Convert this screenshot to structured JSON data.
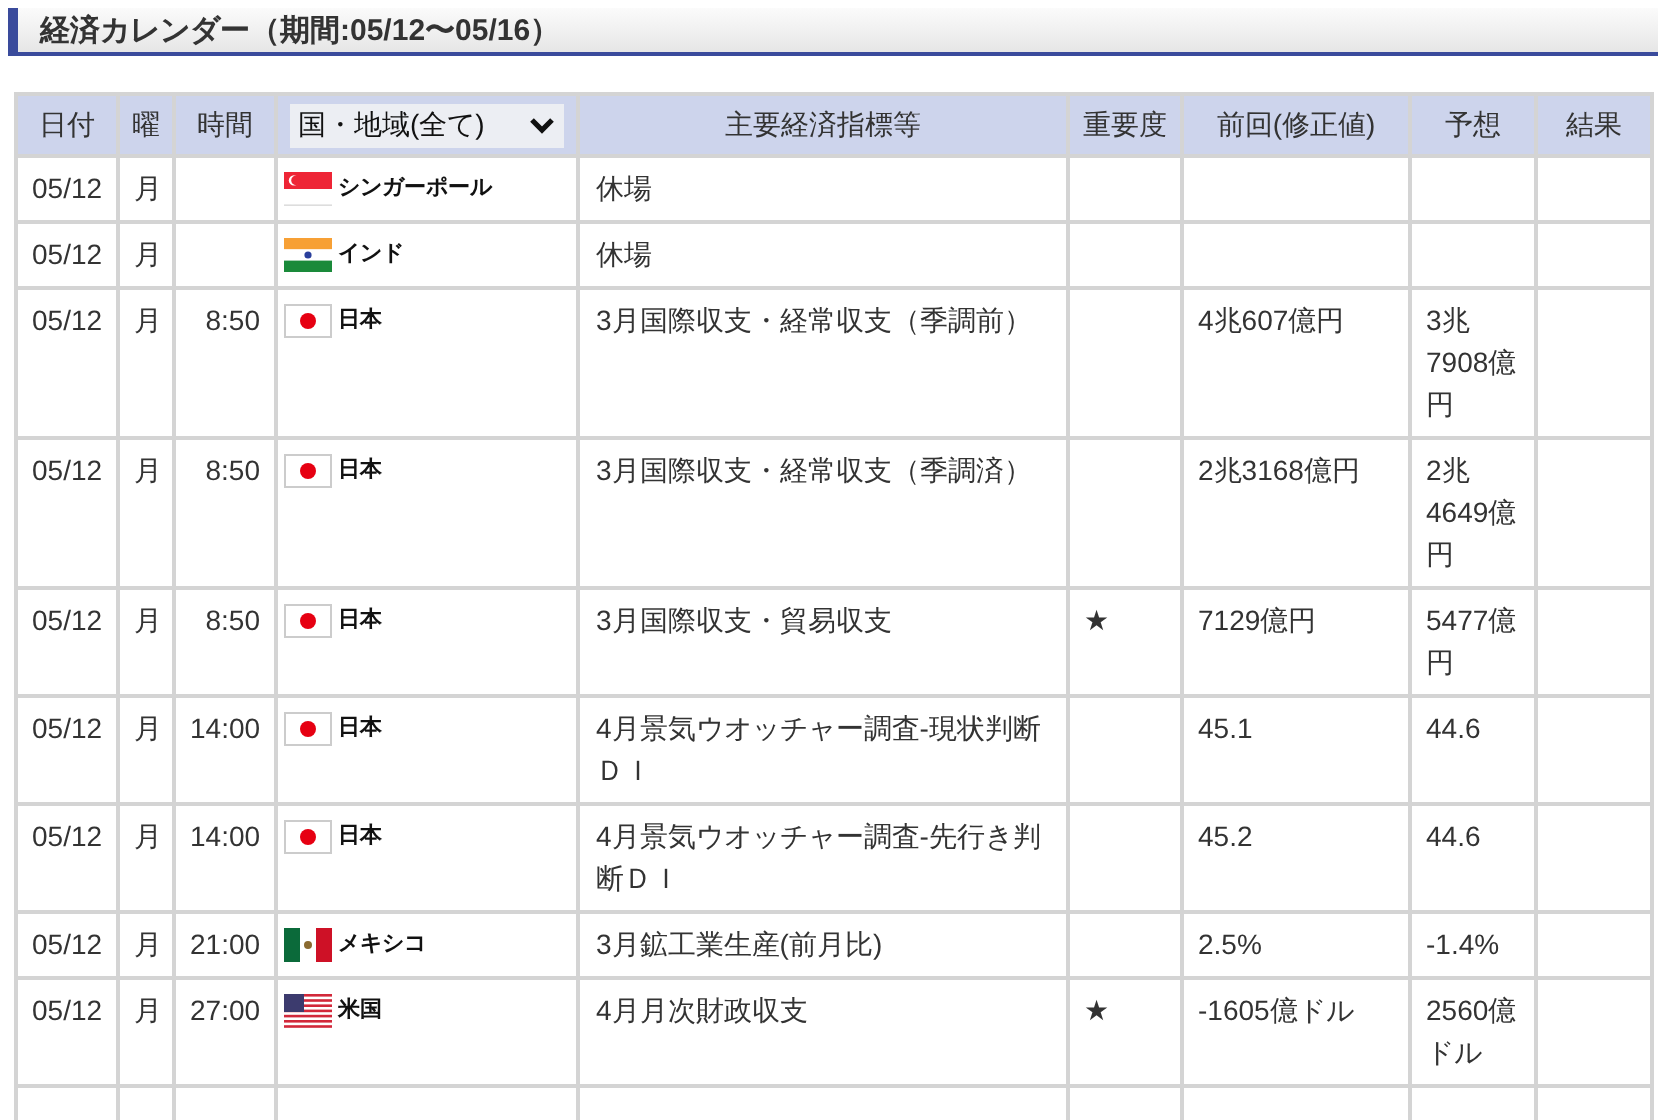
{
  "title": "経済カレンダー（期間:05/12〜05/16）",
  "columns": {
    "date": "日付",
    "day": "曜",
    "time": "時間",
    "region_filter": "国・地域(全て)",
    "indicator": "主要経済指標等",
    "importance": "重要度",
    "previous": "前回(修正値)",
    "forecast": "予想",
    "result": "結果"
  },
  "rows": [
    {
      "date": "05/12",
      "day": "月",
      "kind": "sg",
      "country": "シンガーポール",
      "indicator": "休場"
    },
    {
      "date": "05/12",
      "day": "月",
      "kind": "in",
      "country": "インド",
      "indicator": "休場"
    },
    {
      "date": "05/12",
      "day": "月",
      "time": "8:50",
      "kind": "jp",
      "country": "日本",
      "indicator": "3月国際収支・経常収支（季調前）",
      "previous": "4兆607億円",
      "forecast": "3兆7908億円"
    },
    {
      "date": "05/12",
      "day": "月",
      "time": "8:50",
      "kind": "jp",
      "country": "日本",
      "indicator": "3月国際収支・経常収支（季調済）",
      "previous": "2兆3168億円",
      "forecast": "2兆4649億円"
    },
    {
      "date": "05/12",
      "day": "月",
      "time": "8:50",
      "kind": "jp",
      "country": "日本",
      "indicator": "3月国際収支・貿易収支",
      "importance": "★",
      "previous": "7129億円",
      "forecast": "5477億円"
    },
    {
      "date": "05/12",
      "day": "月",
      "time": "14:00",
      "kind": "jp",
      "country": "日本",
      "indicator": "4月景気ウオッチャー調査-現状判断ＤＩ",
      "previous": "45.1",
      "forecast": "44.6"
    },
    {
      "date": "05/12",
      "day": "月",
      "time": "14:00",
      "kind": "jp",
      "country": "日本",
      "indicator": "4月景気ウオッチャー調査-先行き判断ＤＩ",
      "previous": "45.2",
      "forecast": "44.6"
    },
    {
      "date": "05/12",
      "day": "月",
      "time": "21:00",
      "kind": "mx",
      "country": "メキシコ",
      "indicator": "3月鉱工業生産(前月比)",
      "previous": "2.5%",
      "forecast": "-1.4%"
    },
    {
      "date": "05/12",
      "day": "月",
      "time": "27:00",
      "kind": "us",
      "country": "米国",
      "indicator": "4月月次財政収支",
      "importance": "★",
      "previous": "-1605億ドル",
      "forecast": "2560億ドル"
    }
  ]
}
